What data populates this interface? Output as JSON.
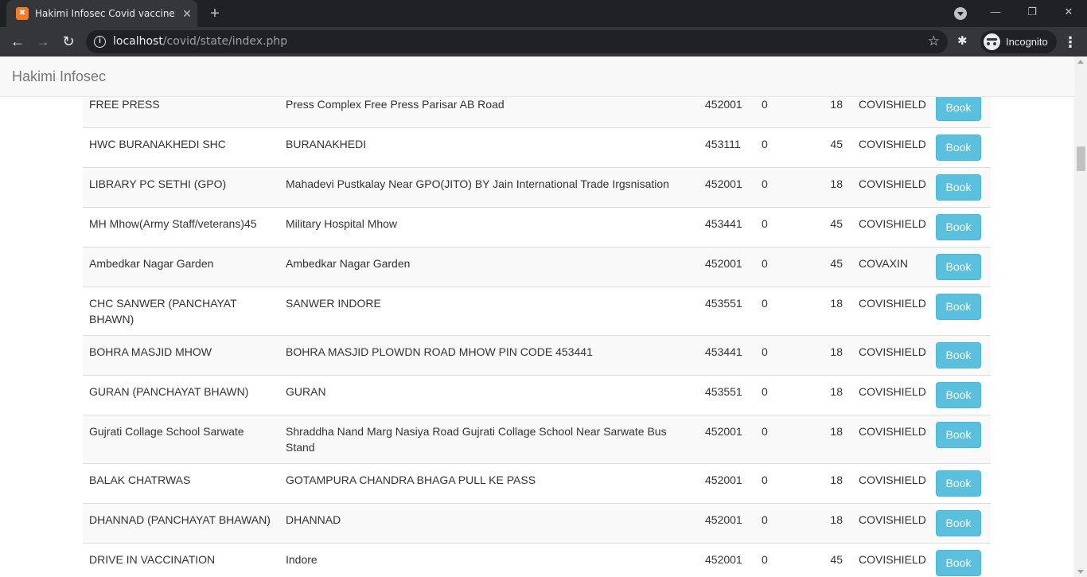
{
  "browser": {
    "tab": {
      "favicon": "xampp-icon",
      "title": "Hakimi Infosec Covid vaccine Slot",
      "close_glyph": "✕"
    },
    "new_tab_glyph": "+",
    "window_controls": {
      "minimize": "—",
      "restore": "❐",
      "close": "✕"
    },
    "nav": {
      "back": "←",
      "forward": "→",
      "reload": "↻"
    },
    "address": {
      "host": "localhost",
      "path": "/covid/state/index.php",
      "info_glyph": "i",
      "star_glyph": "☆"
    },
    "extensions_glyph": "✱",
    "profile_label": "Incognito",
    "menu_glyph": "⋮"
  },
  "navbar": {
    "brand": "Hakimi Infosec"
  },
  "table": {
    "book_label": "Book",
    "rows": [
      {
        "name": "FREE PRESS",
        "address": "Press Complex Free Press Parisar AB Road",
        "pincode": "452001",
        "available": "0",
        "min_age": "18",
        "vaccine": "COVISHIELD"
      },
      {
        "name": "HWC BURANAKHEDI SHC",
        "address": "BURANAKHEDI",
        "pincode": "453111",
        "available": "0",
        "min_age": "45",
        "vaccine": "COVISHIELD"
      },
      {
        "name": "LIBRARY PC SETHI (GPO)",
        "address": "Mahadevi Pustkalay Near GPO(JITO) BY Jain International Trade Irgsnisation",
        "pincode": "452001",
        "available": "0",
        "min_age": "18",
        "vaccine": "COVISHIELD"
      },
      {
        "name": "MH Mhow(Army Staff/veterans)45",
        "address": "Military Hospital Mhow",
        "pincode": "453441",
        "available": "0",
        "min_age": "45",
        "vaccine": "COVISHIELD"
      },
      {
        "name": "Ambedkar Nagar Garden",
        "address": "Ambedkar Nagar Garden",
        "pincode": "452001",
        "available": "0",
        "min_age": "45",
        "vaccine": "COVAXIN"
      },
      {
        "name": "CHC SANWER (PANCHAYAT BHAWN)",
        "address": "SANWER INDORE",
        "pincode": "453551",
        "available": "0",
        "min_age": "18",
        "vaccine": "COVISHIELD"
      },
      {
        "name": "BOHRA MASJID MHOW",
        "address": "BOHRA MASJID PLOWDN ROAD MHOW PIN CODE 453441",
        "pincode": "453441",
        "available": "0",
        "min_age": "18",
        "vaccine": "COVISHIELD"
      },
      {
        "name": "GURAN (PANCHAYAT BHAWN)",
        "address": "GURAN",
        "pincode": "453551",
        "available": "0",
        "min_age": "18",
        "vaccine": "COVISHIELD"
      },
      {
        "name": "Gujrati Collage School Sarwate",
        "address": "Shraddha Nand Marg Nasiya Road Gujrati Collage School Near Sarwate Bus Stand",
        "pincode": "452001",
        "available": "0",
        "min_age": "18",
        "vaccine": "COVISHIELD"
      },
      {
        "name": "BALAK CHATRWAS",
        "address": "GOTAMPURA CHANDRA BHAGA PULL KE PASS",
        "pincode": "452001",
        "available": "0",
        "min_age": "18",
        "vaccine": "COVISHIELD"
      },
      {
        "name": "DHANNAD (PANCHAYAT BHAWAN)",
        "address": "DHANNAD",
        "pincode": "452001",
        "available": "0",
        "min_age": "18",
        "vaccine": "COVISHIELD"
      },
      {
        "name": "DRIVE IN VACCINATION",
        "address": "Indore",
        "pincode": "452001",
        "available": "0",
        "min_age": "45",
        "vaccine": "COVISHIELD"
      }
    ]
  },
  "colors": {
    "book_button": "#5bc0de",
    "row_stripe": "#f9f9f9",
    "browser_frame": "#202124",
    "toolbar": "#35363a"
  }
}
